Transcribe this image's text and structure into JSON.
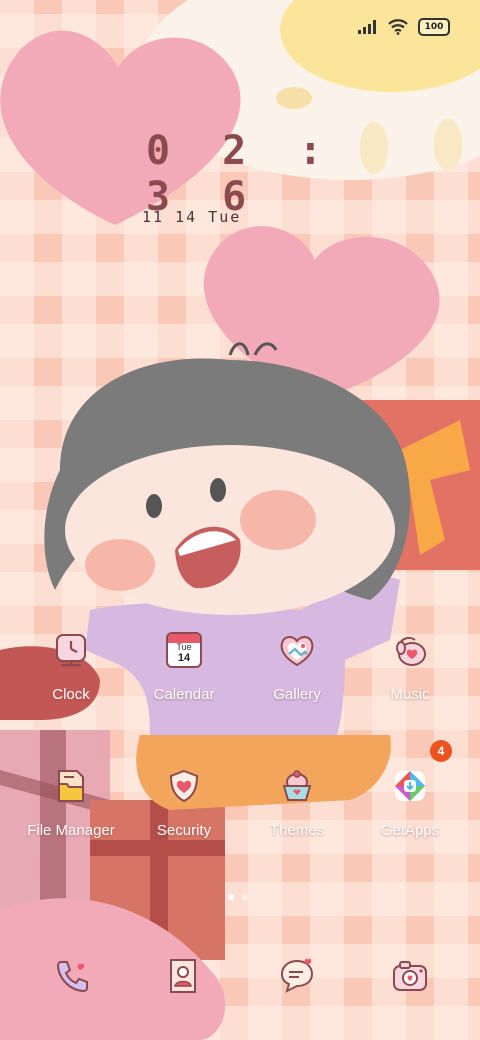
{
  "status": {
    "battery": "100"
  },
  "lock": {
    "time": "0 2 : 3 6",
    "date": "11 14 Tue"
  },
  "apps": [
    {
      "label": "Clock",
      "icon": "clock-icon"
    },
    {
      "label": "Calendar",
      "icon": "calendar-icon",
      "day": "Tue",
      "num": "14"
    },
    {
      "label": "Gallery",
      "icon": "gallery-icon"
    },
    {
      "label": "Music",
      "icon": "music-icon"
    },
    {
      "label": "File Manager",
      "icon": "file-manager-icon"
    },
    {
      "label": "Security",
      "icon": "security-icon"
    },
    {
      "label": "Themes",
      "icon": "themes-icon"
    },
    {
      "label": "GetApps",
      "icon": "getapps-icon",
      "badge": "4"
    }
  ],
  "dock": [
    {
      "icon": "phone-icon"
    },
    {
      "icon": "contacts-icon"
    },
    {
      "icon": "messages-icon"
    },
    {
      "icon": "camera-icon"
    }
  ],
  "colors": {
    "accent": "#e85a6a",
    "icon_outline": "#8a4a50",
    "badge": "#f0521f"
  }
}
